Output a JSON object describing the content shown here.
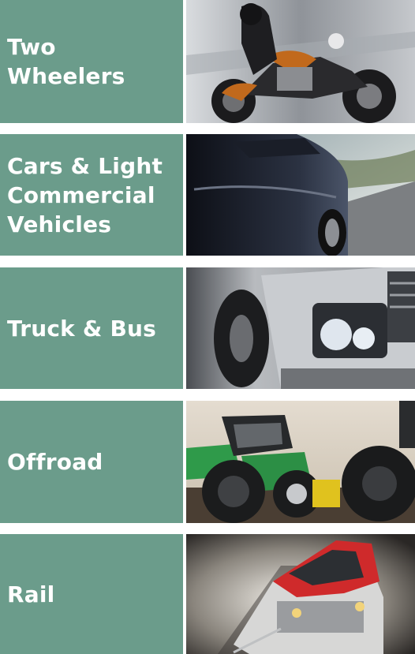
{
  "categories": [
    {
      "label": "Two\nWheelers",
      "image": "motorcycle-photo"
    },
    {
      "label": "Cars & Light\nCommercial\nVehicles",
      "image": "car-photo"
    },
    {
      "label": "Truck & Bus",
      "image": "truck-photo"
    },
    {
      "label": "Offroad",
      "image": "tractor-photo"
    },
    {
      "label": "Rail",
      "image": "train-photo"
    }
  ],
  "colors": {
    "tile": "#6b9c8b",
    "text": "#ffffff"
  }
}
